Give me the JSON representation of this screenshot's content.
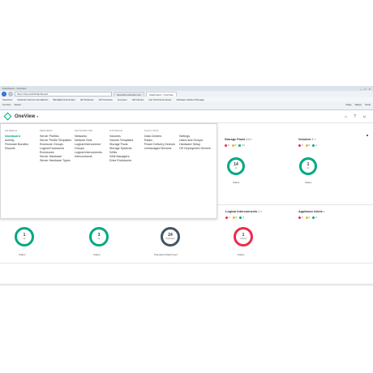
{
  "browser": {
    "tabs": [
      {
        "label": "hpeov01.example.com"
      },
      {
        "label": "Dashboard - OneView",
        "active": true
      }
    ],
    "address": "https://hpeov01/#/dashboard",
    "favorites": [
      "Favorites",
      "Solutions Recommendations",
      "Backlight Reminders",
      "HP Reliance",
      "HP OneView",
      "Licenses",
      "HP Fabrics",
      "Get Technical Library",
      "Software Defined Storage"
    ],
    "commands": [
      "Convert",
      "Select"
    ],
    "command_right": [
      "Page",
      "Safety",
      "Tools"
    ]
  },
  "app": {
    "name": "OneView",
    "icons": [
      "home-icon",
      "help-icon",
      "user-icon"
    ]
  },
  "menu": {
    "columns": [
      {
        "heading": "GENERAL",
        "items": [
          "Dashboard",
          "Activity",
          "Firmware Bundles",
          "Reports"
        ]
      },
      {
        "heading": "SERVERS",
        "items": [
          "Server Profiles",
          "Server Profile Templates",
          "Enclosure Groups",
          "Logical Enclosures",
          "Enclosures",
          "Server Hardware",
          "Server Hardware Types"
        ]
      },
      {
        "heading": "NETWORKING",
        "items": [
          "Networks",
          "Network Sets",
          "Logical Interconnect Groups",
          "Logical Interconnects",
          "Interconnects"
        ]
      },
      {
        "heading": "STORAGE",
        "items": [
          "Volumes",
          "Volume Templates",
          "Storage Pools",
          "Storage Systems",
          "SANs",
          "SAN Managers",
          "Drive Enclosures"
        ]
      },
      {
        "heading": "FACILITIES",
        "items": [
          "Data Centers",
          "Racks",
          "Power Delivery Devices",
          "Unmanaged Devices"
        ]
      },
      {
        "heading": "",
        "items": [
          "Settings",
          "Users and Groups",
          "Hardware Setup",
          "OS Deployment Servers"
        ]
      }
    ]
  },
  "top_panels": [
    {
      "title": "Storage Pools",
      "count": "14",
      "stats": [
        "0",
        "0",
        "14"
      ],
      "value": "14",
      "sub": "ok",
      "caption": "Status"
    },
    {
      "title": "Volumes",
      "count": "1",
      "stats": [
        "0",
        "0",
        "1"
      ],
      "value": "1",
      "sub": "ok",
      "caption": "Status"
    }
  ],
  "bottom_panels": [
    {
      "title": "Logical Enclosures",
      "count": "1",
      "stats": [
        "0",
        "0",
        "1"
      ],
      "value": "1",
      "sub": "ok",
      "caption": "Status",
      "color": "#01a982"
    },
    {
      "title": "Enclosures",
      "count": "3",
      "stats": [
        "0",
        "0",
        "3"
      ],
      "value": "3",
      "sub": "ok",
      "caption": "Status",
      "color": "#01a982"
    },
    {
      "title": "Blade bays",
      "count": "36",
      "stats": [],
      "value": "24",
      "sub": "Populated",
      "caption": "Populated blade bays",
      "color": "#425563"
    },
    {
      "title": "Logical Interconnects",
      "count": "1",
      "stats": [
        "1",
        "0",
        "0"
      ],
      "value": "1",
      "sub": "Critical",
      "caption": "Status",
      "color": "#ec2a4b"
    },
    {
      "title": "Appliance Alerts",
      "count": "",
      "stats": [
        "0",
        "0",
        "0"
      ],
      "value": "",
      "sub": "",
      "caption": "",
      "color": ""
    }
  ]
}
